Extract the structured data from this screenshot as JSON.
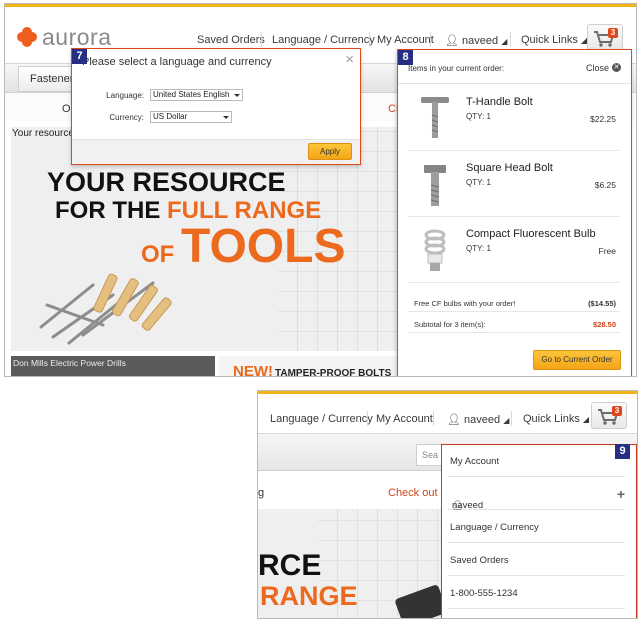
{
  "brand": {
    "name": "aurora",
    "color": "#ee5f1f"
  },
  "header": {
    "links": [
      "Saved Orders",
      "Language / Currency",
      "My Account"
    ],
    "user": "naveed",
    "quick_links": "Quick Links",
    "cart_count": "3"
  },
  "nav": {
    "tab": "Fasteners"
  },
  "promo": {
    "left": "Or",
    "right": "Ch"
  },
  "hero": {
    "caption": "Your resource",
    "line1": "YOUR RESOURCE",
    "line2a": "FOR THE ",
    "line2b": "FULL RANGE",
    "line3a": "OF ",
    "line3b": "TOOLS"
  },
  "tiles": {
    "tile1": "Don Mills Electric Power Drills",
    "tile2_new": "NEW!",
    "tile2_rest": "TAMPER-PROOF BOLTS"
  },
  "language_dialog": {
    "title": "Please select a language and currency",
    "language_label": "Language:",
    "language_value": "United States English",
    "currency_label": "Currency:",
    "currency_value": "US Dollar",
    "apply": "Apply",
    "close": "×"
  },
  "cart": {
    "title": "Items in your current order:",
    "close": "Close",
    "items": [
      {
        "name": "T-Handle Bolt",
        "qty": "QTY: 1",
        "price": "$22.25"
      },
      {
        "name": "Square Head Bolt",
        "qty": "QTY: 1",
        "price": "$6.25"
      },
      {
        "name": "Compact Fluorescent Bulb",
        "qty": "QTY: 1",
        "price": "Free"
      }
    ],
    "promo_label": "Free CF bulbs with your order!",
    "promo_value": "($14.55)",
    "subtotal_label": "Subtotal for 3 item(s):",
    "subtotal_value": "$28.50",
    "goto": "Go to Current Order"
  },
  "callouts": {
    "c7": "7",
    "c8": "8",
    "c9": "9"
  },
  "shot2": {
    "links": [
      "Language / Currency",
      "My Account"
    ],
    "user": "naveed",
    "quick_links": "Quick Links",
    "cart_count": "3",
    "search_placeholder": "Sea",
    "promo_left": "g",
    "promo_right": "Check out o",
    "hero_line1": "RCE",
    "hero_line2": "RANGE",
    "menu": {
      "items": [
        "My Account",
        "naveed",
        "Language / Currency",
        "Saved Orders",
        "1-800-555-1234"
      ],
      "expand": "+"
    }
  },
  "colors": {
    "accent": "#ee5f1f",
    "callout": "#262f83",
    "button": "#f4a417",
    "topbar": "#f3b31b"
  }
}
